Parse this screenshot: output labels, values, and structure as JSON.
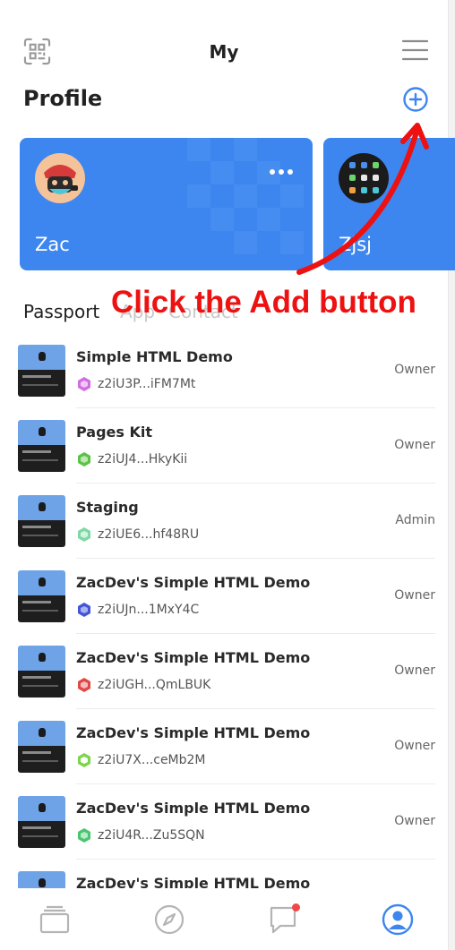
{
  "header": {
    "title": "My",
    "scan_icon": "qr-scan-icon",
    "menu_icon": "hamburger-menu-icon"
  },
  "profile": {
    "title": "Profile",
    "add_icon": "plus-circle-icon",
    "cards": [
      {
        "name": "Zac",
        "avatar": "masked-character-avatar",
        "more_icon": "more-dots-icon"
      },
      {
        "name": "Zjsj",
        "avatar": "app-grid-avatar"
      }
    ]
  },
  "annotation": {
    "text": "Click the Add button",
    "color": "#ee1111"
  },
  "tabs": [
    {
      "label": "Passport",
      "active": true
    },
    {
      "label": "App",
      "active": false
    },
    {
      "label": "Contact",
      "active": false
    }
  ],
  "passports": [
    {
      "title": "Simple HTML Demo",
      "id": "z2iU3P...iFM7Mt",
      "role": "Owner",
      "gem_color": "#d06ee0"
    },
    {
      "title": "Pages Kit",
      "id": "z2iUJ4...HkyKii",
      "role": "Owner",
      "gem_color": "#5cc24a"
    },
    {
      "title": "Staging",
      "id": "z2iUE6...hf48RU",
      "role": "Admin",
      "gem_color": "#7ed9a4"
    },
    {
      "title": "ZacDev's Simple HTML Demo",
      "id": "z2iUJn...1MxY4C",
      "role": "Owner",
      "gem_color": "#4456d6"
    },
    {
      "title": "ZacDev's Simple HTML Demo",
      "id": "z2iUGH...QmLBUK",
      "role": "Owner",
      "gem_color": "#e04848"
    },
    {
      "title": "ZacDev's Simple HTML Demo",
      "id": "z2iU7X...ceMb2M",
      "role": "Owner",
      "gem_color": "#7ad64a"
    },
    {
      "title": "ZacDev's Simple HTML Demo",
      "id": "z2iU4R...Zu5SQN",
      "role": "Owner",
      "gem_color": "#4cc470"
    },
    {
      "title": "ZacDev's Simple HTML Demo",
      "id": "",
      "role": "",
      "gem_color": "#8888cc"
    }
  ],
  "bottom_nav": [
    {
      "icon": "wallet-cards-icon",
      "active": false
    },
    {
      "icon": "compass-icon",
      "active": false
    },
    {
      "icon": "chat-bubble-icon",
      "active": false,
      "badge": true
    },
    {
      "icon": "user-profile-icon",
      "active": true
    }
  ],
  "colors": {
    "accent": "#3d86f0",
    "card_bg": "#3d86f0",
    "badge": "#f04848"
  }
}
